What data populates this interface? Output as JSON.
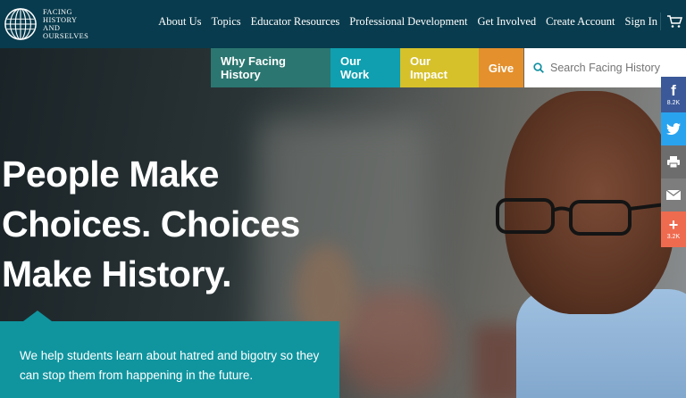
{
  "brand": {
    "logo_lines": "FACING\nHISTORY\nAND\nOURSELVES"
  },
  "topnav": [
    "About Us",
    "Topics",
    "Educator Resources",
    "Professional Development",
    "Get Involved",
    "Create Account",
    "Sign In"
  ],
  "subnav": {
    "why": "Why Facing History",
    "work": "Our Work",
    "impact": "Our Impact",
    "give": "Give"
  },
  "search": {
    "placeholder": "Search Facing History"
  },
  "hero": {
    "headline": "People Make Choices. Choices Make History.",
    "blurb": "We help students learn about hatred and bigotry so they can stop them from happening in the future."
  },
  "share": {
    "facebook_count": "8.2K",
    "add_count": "3.2K"
  },
  "icons": [
    "globe-logo-icon",
    "cart-icon",
    "search-icon",
    "facebook-icon",
    "twitter-icon",
    "print-icon",
    "email-icon",
    "plus-icon"
  ],
  "colors": {
    "header": "#083b4d",
    "teal": "#10959f",
    "why": "#2b7670",
    "impact": "#d6c12b",
    "give": "#e4902c"
  }
}
